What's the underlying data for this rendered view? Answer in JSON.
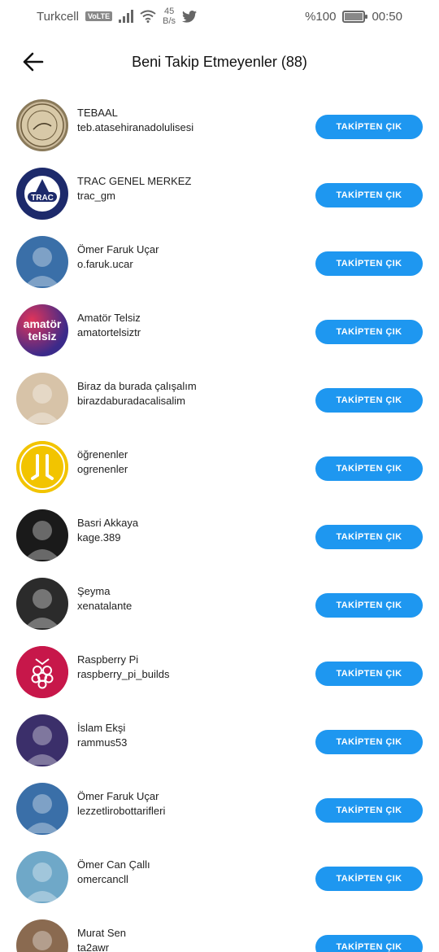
{
  "status_bar": {
    "carrier": "Turkcell",
    "volte": "VoLTE",
    "speed_value": "45",
    "speed_unit": "B/s",
    "battery": "%100",
    "time": "00:50"
  },
  "header": {
    "title": "Beni Takip Etmeyenler (88)"
  },
  "button_label": "TAKİPTEN ÇIK",
  "users": [
    {
      "name": "TEBAAL",
      "handle": "teb.atasehiranadolulisesi",
      "avatar": "seal",
      "color": "#c9b89a"
    },
    {
      "name": "TRAC GENEL MERKEZ",
      "handle": "trac_gm",
      "avatar": "trac",
      "color": "#1d2a6b"
    },
    {
      "name": "Ömer Faruk Uçar",
      "handle": "o.faruk.ucar",
      "avatar": "photo",
      "color": "#3a6fa8"
    },
    {
      "name": "Amatör Telsiz",
      "handle": "amatortelsiztr",
      "avatar": "text",
      "color": "#3b2a8a"
    },
    {
      "name": "Biraz da burada çalışalım",
      "handle": "birazdaburadacalisalim",
      "avatar": "photo",
      "color": "#d7c3a8"
    },
    {
      "name": "öğrenenler",
      "handle": "ogrenenler",
      "avatar": "logo",
      "color": "#f2c400"
    },
    {
      "name": "Basri Akkaya",
      "handle": "kage.389",
      "avatar": "photo",
      "color": "#1a1a1a"
    },
    {
      "name": "Şeyma",
      "handle": "xenatalante",
      "avatar": "photo",
      "color": "#2b2b2b"
    },
    {
      "name": "Raspberry Pi",
      "handle": "raspberry_pi_builds",
      "avatar": "rpi",
      "color": "#c7174a"
    },
    {
      "name": "İslam Ekşi",
      "handle": "rammus53",
      "avatar": "photo",
      "color": "#3b2f6a"
    },
    {
      "name": "Ömer Faruk Uçar",
      "handle": "lezzetlirobottarifleri",
      "avatar": "photo",
      "color": "#3a6fa8"
    },
    {
      "name": "Ömer Can Çallı",
      "handle": "omercancll",
      "avatar": "photo",
      "color": "#6fa8c8"
    },
    {
      "name": "Murat Sen",
      "handle": "ta2awr",
      "avatar": "photo",
      "color": "#8a6a50"
    }
  ],
  "avatar_text": {
    "trac": "TRAC",
    "amator_line1": "amatör",
    "amator_line2": "telsiz"
  }
}
